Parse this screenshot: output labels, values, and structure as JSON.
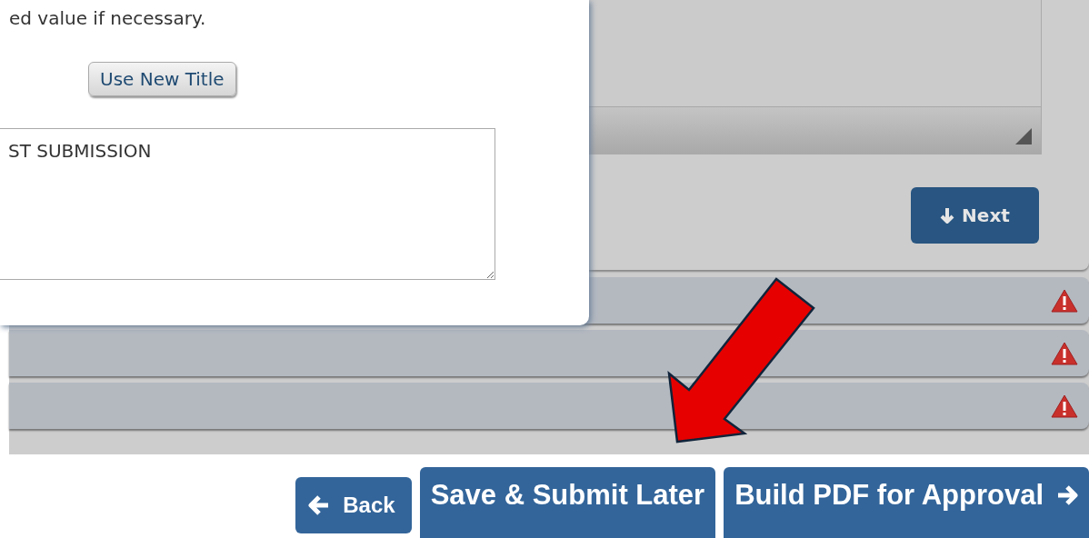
{
  "dialog": {
    "instruction": "ed value if necessary.",
    "use_button": "Use New Title",
    "title_field": {
      "value": "ST SUBMISSION"
    }
  },
  "panel": {
    "next_button": "Next"
  },
  "sections": [
    {
      "warning": true
    },
    {
      "warning": true
    },
    {
      "warning": true
    }
  ],
  "footer": {
    "buttons": [
      {
        "label": "Back",
        "kind": "back"
      },
      {
        "label": "Save & Submit Later",
        "kind": "plain"
      },
      {
        "label": "Build PDF for Approval",
        "kind": "forward"
      }
    ]
  }
}
